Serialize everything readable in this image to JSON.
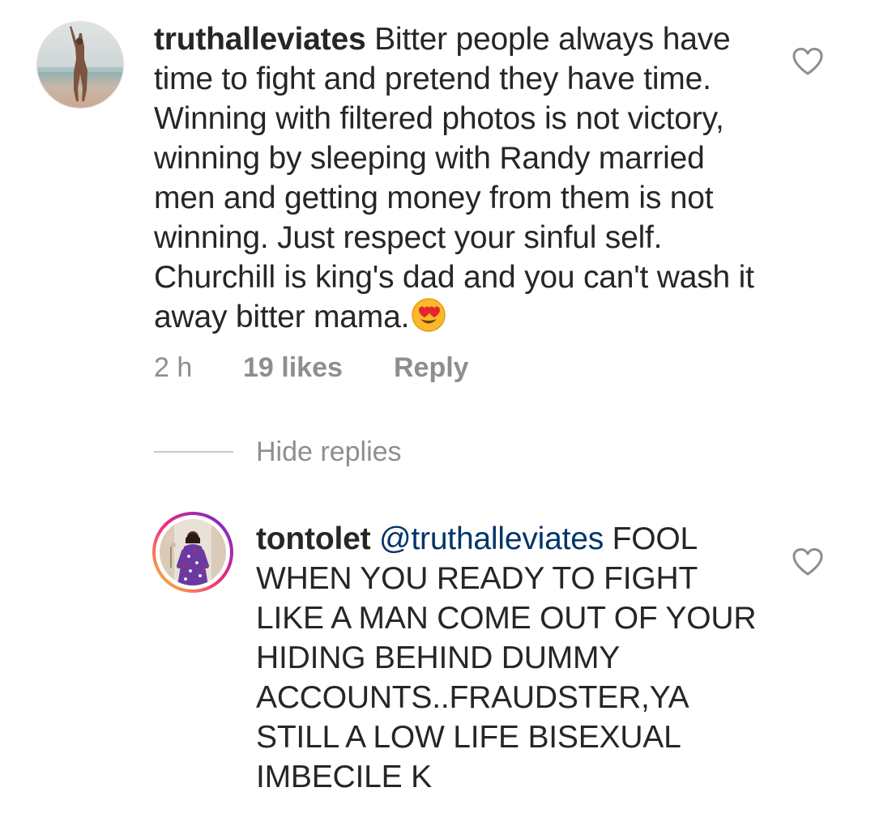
{
  "comment": {
    "username": "truthalleviates",
    "text": " Bitter people always have time to fight and pretend they have time. Winning with filtered photos is not victory, winning by sleeping with Randy married men and getting money from them is not winning. Just respect your sinful self. Churchill is king's dad and you can't wash it away bitter mama.",
    "emoji": "heart-eyes-emoji",
    "time": "2 h",
    "likes": "19 likes",
    "reply_label": "Reply",
    "like_icon": "heart-outline-icon"
  },
  "replies_toggle": {
    "label": "Hide replies"
  },
  "reply": {
    "username": "tontolet",
    "mention": "@truthalleviates",
    "text": " FOOL WHEN YOU READY TO FIGHT LIKE A MAN COME OUT OF YOUR HIDING BEHIND DUMMY ACCOUNTS..FRAUDSTER,YA STILL A LOW LIFE BISEXUAL IMBECILE K",
    "like_icon": "heart-outline-icon"
  },
  "colors": {
    "text": "#262626",
    "secondary": "#8e8e8e",
    "mention": "#003569",
    "story_ring_start": "#f9ce34",
    "story_ring_mid": "#ee2a7b",
    "story_ring_end": "#6228d7"
  }
}
